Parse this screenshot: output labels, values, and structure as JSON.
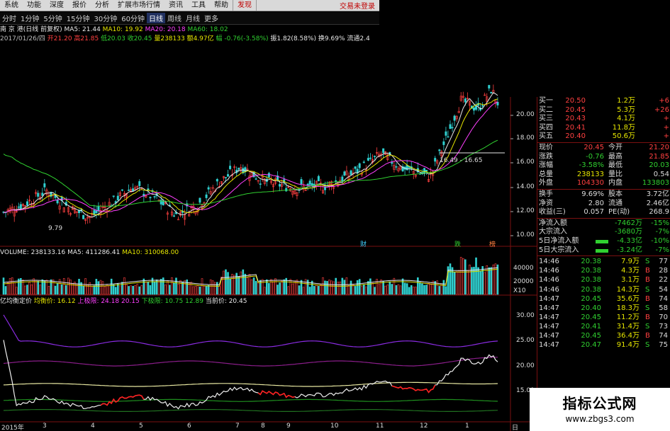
{
  "menu": {
    "items": [
      "系统",
      "功能",
      "深度",
      "报价",
      "分析",
      "扩展市场行情",
      "资讯",
      "工具",
      "帮助"
    ],
    "active": "发现",
    "right": "交易未登录"
  },
  "periods": [
    "分时",
    "1分钟",
    "5分钟",
    "15分钟",
    "30分钟",
    "60分钟",
    "日线",
    "周线",
    "月线",
    "更多"
  ],
  "info1": {
    "name": "南 京 港(日线 前复权)",
    "ma5": "MA5: 21.44",
    "ma10": "MA10: 19.92",
    "ma20": "MA20: 20.18",
    "ma60": "MA60: 18.02"
  },
  "info2": {
    "date": "2017/01/26/四",
    "open": "开21.20",
    "high": "高21.85",
    "low": "低20.03",
    "close": "收20.45",
    "volume": "量238133",
    "amount": "额4.97亿",
    "change": "幅 -0.76(-3.58%)",
    "amplitude": "振1.82(8.58%)",
    "turnover": "换9.69%",
    "circulation": "流通2.4"
  },
  "price_axis": [
    "20.00",
    "18.00",
    "16.00",
    "14.00",
    "12.00",
    "10.00"
  ],
  "range_label": "16.49 - 16.65",
  "low_label": "9.79",
  "markers": [
    "财",
    "跌",
    "榜"
  ],
  "volume_info": {
    "vol": "VOLUME: 238133.16",
    "ma5": "MA5: 411286.41",
    "ma10": "MA10: 310068.00"
  },
  "volume_axis": [
    "40000",
    "20000",
    "X10"
  ],
  "cost_info": {
    "name": "亿均衡定价",
    "avg": "均衡价: 16.12",
    "upper": "上极限: 24.18",
    "upper2": "20.15",
    "lower": "下极限: 10.75",
    "lower2": "12.89",
    "current": "当前价: 20.45"
  },
  "cost_axis": [
    "30.00",
    "25.00",
    "20.00",
    "15.00"
  ],
  "time_axis": [
    "2015年",
    "3",
    "4",
    "5",
    "6",
    "7",
    "8",
    "9",
    "10",
    "11",
    "12",
    "1",
    "日线"
  ],
  "quote": {
    "bids": [
      {
        "label": "买一",
        "price": "20.50",
        "vol": "1.2万",
        "delta": "+6"
      },
      {
        "label": "买二",
        "price": "20.45",
        "vol": "5.3万",
        "delta": "+26"
      },
      {
        "label": "买三",
        "price": "20.43",
        "vol": "4.1万",
        "delta": "+"
      },
      {
        "label": "买四",
        "price": "20.41",
        "vol": "11.8万",
        "delta": "+"
      },
      {
        "label": "买五",
        "price": "20.40",
        "vol": "50.6万",
        "delta": "+"
      }
    ],
    "stats": [
      {
        "l1": "现价",
        "v1": "20.45",
        "l2": "今开",
        "v2": "21.20"
      },
      {
        "l1": "涨跌",
        "v1": "-0.76",
        "l2": "最高",
        "v2": "21.85"
      },
      {
        "l1": "涨幅",
        "v1": "-3.58%",
        "l2": "最低",
        "v2": "20.03"
      },
      {
        "l1": "总量",
        "v1": "238133",
        "l2": "量比",
        "v2": "0.54"
      },
      {
        "l1": "外盘",
        "v1": "104330",
        "l2": "内盘",
        "v2": "133803"
      }
    ],
    "stats2": [
      {
        "l1": "换手",
        "v1": "9.69%",
        "l2": "股本",
        "v2": "3.72亿"
      },
      {
        "l1": "净资",
        "v1": "2.80",
        "l2": "流通",
        "v2": "2.46亿"
      },
      {
        "l1": "收益(三)",
        "v1": "0.057",
        "l2": "PE(动)",
        "v2": "268.9"
      }
    ],
    "flows": [
      {
        "label": "净流入额",
        "value": "-7462万",
        "pct": "-15%"
      },
      {
        "label": "大宗流入",
        "value": "-3680万",
        "pct": "-7%"
      },
      {
        "label": "5日净流入额",
        "value": "-4.33亿",
        "pct": "-10%"
      },
      {
        "label": "5日大宗流入",
        "value": "-3.24亿",
        "pct": "-7%"
      }
    ],
    "ticks": [
      {
        "time": "14:46",
        "price": "20.38",
        "vol": "7.9万",
        "side": "S",
        "n": "77"
      },
      {
        "time": "14:46",
        "price": "20.38",
        "vol": "4.3万",
        "side": "B",
        "n": "28"
      },
      {
        "time": "14:46",
        "price": "20.38",
        "vol": "3.1万",
        "side": "B",
        "n": "22"
      },
      {
        "time": "14:46",
        "price": "20.38",
        "vol": "14.3万",
        "side": "S",
        "n": "54"
      },
      {
        "time": "14:47",
        "price": "20.45",
        "vol": "35.6万",
        "side": "B",
        "n": "74"
      },
      {
        "time": "14:47",
        "price": "20.40",
        "vol": "18.3万",
        "side": "S",
        "n": "58"
      },
      {
        "time": "14:47",
        "price": "20.45",
        "vol": "11.2万",
        "side": "B",
        "n": "70"
      },
      {
        "time": "14:47",
        "price": "20.41",
        "vol": "31.4万",
        "side": "S",
        "n": "73"
      },
      {
        "time": "14:47",
        "price": "20.45",
        "vol": "36.4万",
        "side": "B",
        "n": "74"
      },
      {
        "time": "14:47",
        "price": "20.47",
        "vol": "91.4万",
        "side": "S",
        "n": "75"
      }
    ]
  },
  "watermark": {
    "title": "指标公式网",
    "url": "www.zbgs3.com"
  },
  "colors": {
    "up": "#ff4040",
    "down": "#30d0d0",
    "ma5": "#e8e8e8",
    "ma10": "#e6e600",
    "ma20": "#ff40ff",
    "ma60": "#30d030",
    "border": "#7a1010"
  }
}
